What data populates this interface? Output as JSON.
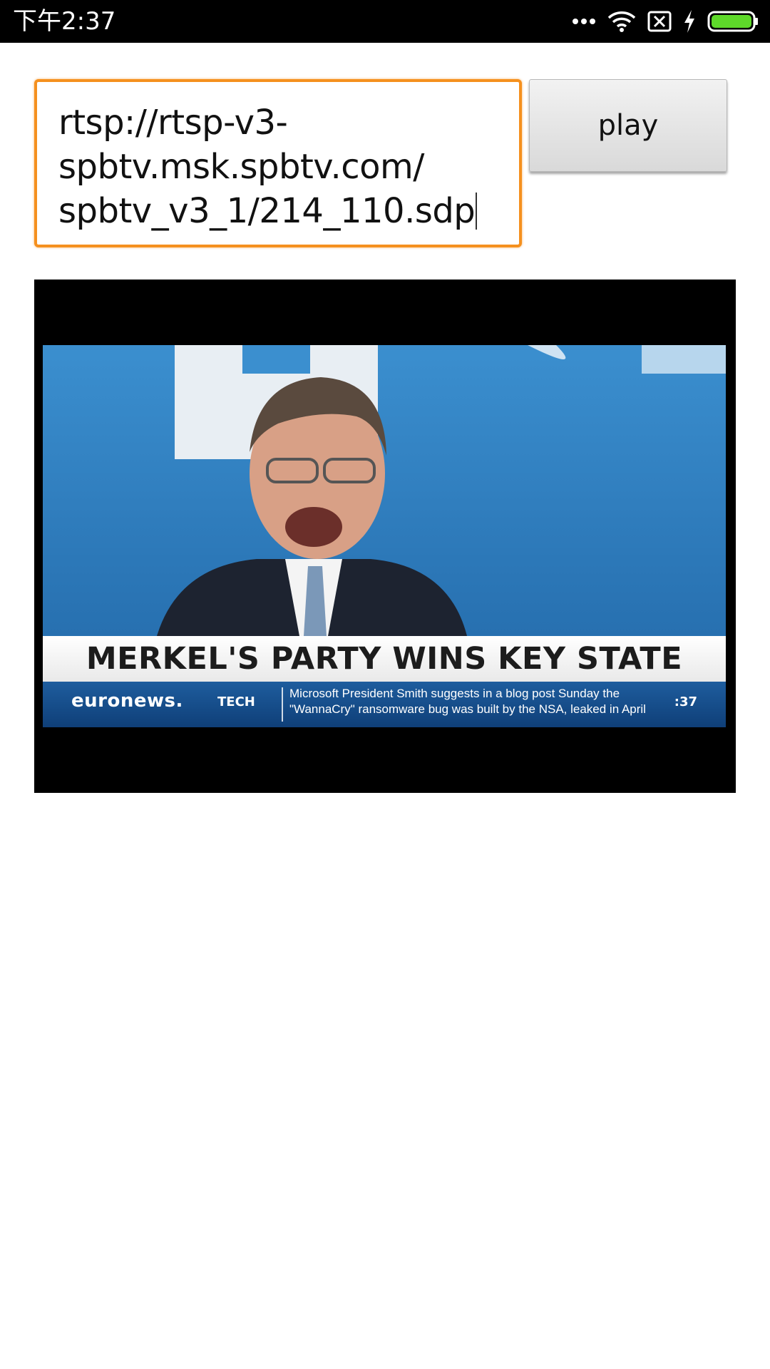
{
  "status_bar": {
    "time": "下午2:37",
    "icons": [
      "more-dots-icon",
      "wifi-icon",
      "sim-off-icon",
      "charging-bolt-icon",
      "battery-icon"
    ],
    "battery_color": "#5ed92a"
  },
  "url_input": {
    "value_lines": [
      "rtsp://rtsp-v3-",
      "spbtv.msk.spbtv.com/",
      "spbtv_v3_1/214_110.sdp"
    ],
    "focus_border_color": "#f5901e"
  },
  "play_button": {
    "label": "play"
  },
  "video": {
    "headline": "MERKEL'S PARTY WINS KEY STATE",
    "ticker_logo": "euronews.",
    "ticker_section": "TECH",
    "ticker_lines": [
      "Microsoft President Smith suggests in a blog post Sunday the",
      "\"WannaCry\" ransomware bug was built by the NSA, leaked in April"
    ],
    "ticker_time": ":37"
  }
}
